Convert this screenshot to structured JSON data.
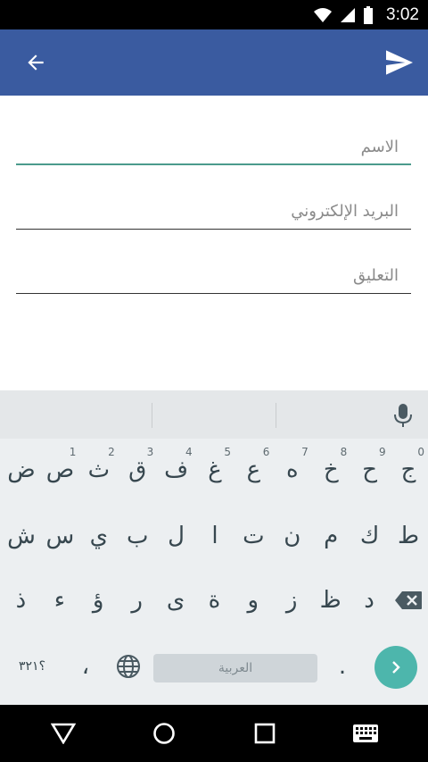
{
  "status_bar": {
    "time": "3:02"
  },
  "app_bar": {
    "color": "#3a5ba0"
  },
  "form": {
    "name_placeholder": "الاسم",
    "email_placeholder": "البريد الإلكتروني",
    "comment_placeholder": "التعليق"
  },
  "keyboard": {
    "row1": [
      {
        "char": "ج",
        "hint": "0"
      },
      {
        "char": "ح",
        "hint": "9"
      },
      {
        "char": "خ",
        "hint": "8"
      },
      {
        "char": "ه",
        "hint": "7"
      },
      {
        "char": "ع",
        "hint": "6"
      },
      {
        "char": "غ",
        "hint": "5"
      },
      {
        "char": "ف",
        "hint": "4"
      },
      {
        "char": "ق",
        "hint": "3"
      },
      {
        "char": "ث",
        "hint": "2"
      },
      {
        "char": "ص",
        "hint": "1"
      },
      {
        "char": "ض",
        "hint": ""
      }
    ],
    "row2": [
      "ط",
      "ك",
      "م",
      "ن",
      "ت",
      "ا",
      "ل",
      "ب",
      "ي",
      "س",
      "ش"
    ],
    "row3": [
      "د",
      "ظ",
      "ز",
      "و",
      "ة",
      "ى",
      "ر",
      "ؤ",
      "ء",
      "ذ"
    ],
    "row4": {
      "numbers_label": "؟٣٢١",
      "comma": "،",
      "period": ".",
      "language_label": "العربية"
    },
    "enter_color": "#4db6ac"
  }
}
